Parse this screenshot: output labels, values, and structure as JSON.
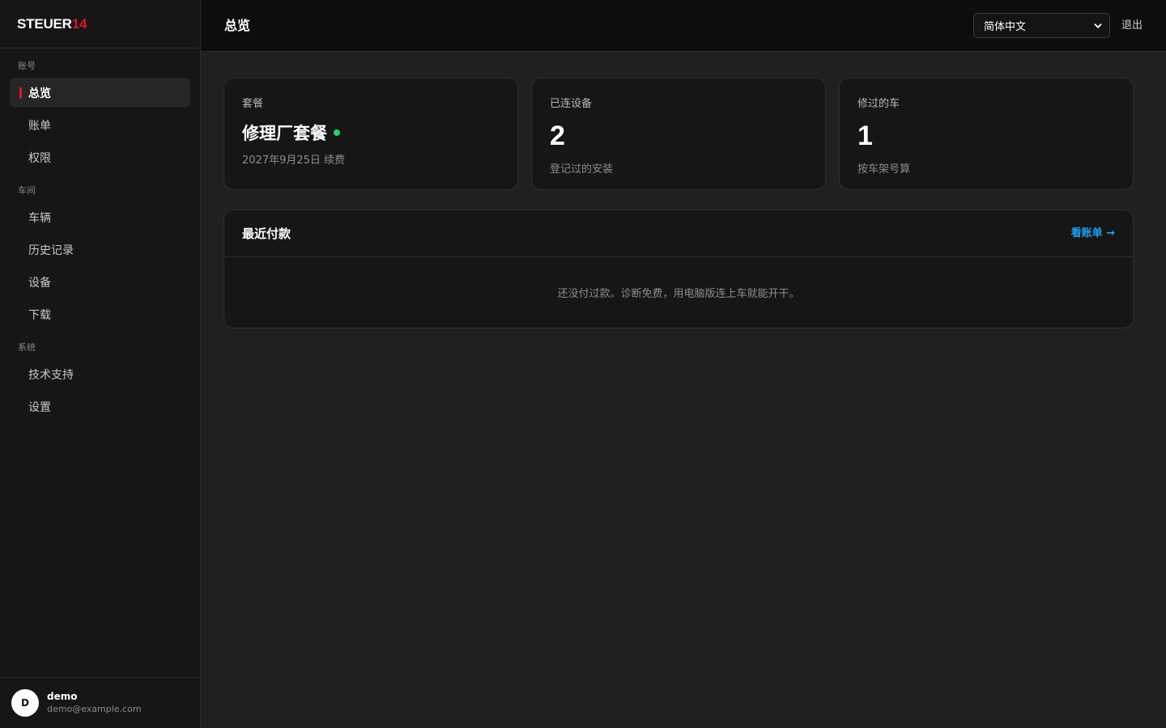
{
  "brand": {
    "name_main": "STEUER",
    "name_accent": "14",
    "accent_color": "#d7172d"
  },
  "sidebar": {
    "sections": [
      {
        "label": "账号",
        "items": [
          {
            "label": "总览",
            "active": true
          },
          {
            "label": "账单"
          },
          {
            "label": "权限"
          }
        ]
      },
      {
        "label": "车间",
        "items": [
          {
            "label": "车辆"
          },
          {
            "label": "历史记录"
          },
          {
            "label": "设备"
          },
          {
            "label": "下载"
          }
        ]
      },
      {
        "label": "系统",
        "items": [
          {
            "label": "技术支持"
          },
          {
            "label": "设置"
          }
        ]
      }
    ],
    "user": {
      "initial": "D",
      "name": "demo",
      "email": "demo@example.com"
    }
  },
  "header": {
    "title": "总览",
    "language": {
      "selected": "简体中文"
    },
    "logout_label": "退出"
  },
  "cards": {
    "plan": {
      "label": "套餐",
      "name": "修理厂套餐",
      "status_color": "#22d36a",
      "renewal": "2027年9月25日 续费"
    },
    "devices": {
      "label": "已连设备",
      "value": "2",
      "sub": "登记过的安装"
    },
    "vehicles": {
      "label": "修过的车",
      "value": "1",
      "sub": "按车架号算"
    }
  },
  "payments": {
    "title": "最近付款",
    "link_label": "看账单 →",
    "empty_text": "还没付过款。诊断免费，用电脑版连上车就能开干。"
  }
}
